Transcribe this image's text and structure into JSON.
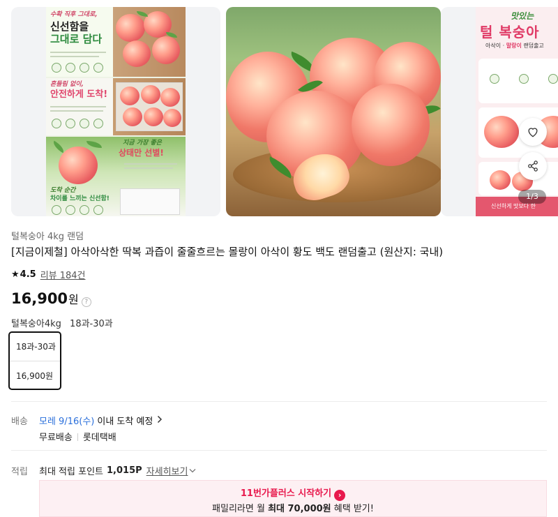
{
  "carousel": {
    "slide1": {
      "header_small": "수확 직후 그대로,",
      "header_big_1": "신선함을",
      "header_big_2": "그대로 담다",
      "mid_small": "흔들림 없이,",
      "mid_big": "안전하게 도착!",
      "bottom_small": "지금 가장 좋은",
      "bottom_big": "상태만 선별!",
      "bottom_left_small": "도착 순간",
      "bottom_left_big": "차이를 느끼는 신선함!"
    },
    "slide3": {
      "title_small": "맛있는",
      "title": "털 복숭아",
      "subtitle_pre": "아삭이 · ",
      "subtitle_highlight": "말랑이",
      "subtitle_post": " 랜덤출고",
      "banner": "신선하게 맛보다 한"
    },
    "counter": "1/3",
    "icons": {
      "wishlist": "heart-icon",
      "share": "share-icon"
    }
  },
  "product": {
    "category_label": "털복숭아 4kg 랜덤",
    "title": "[지금이제철] 아삭아삭한 딱복 과즙이 줄줄흐르는 몰랑이 아삭이 황도 백도 랜덤출고 (원산지: 국내)",
    "rating": "4.5",
    "review_label": "리뷰 184건",
    "price": "16,900",
    "price_unit": "원",
    "option_name": "털복숭아4kg",
    "option_value": "18과-30과"
  },
  "option_card": {
    "label": "18과-30과",
    "price": "16,900원"
  },
  "shipping": {
    "label": "배송",
    "date": "모레 9/16(수)",
    "date_suffix": "이내 도착 예정",
    "fee": "무료배송",
    "carrier": "롯데택배"
  },
  "points": {
    "label": "적립",
    "text": "최대 적립 포인트",
    "amount": "1,015P",
    "more": "자세히보기"
  },
  "promo": {
    "title": "11번가플러스 시작하기",
    "line_pre": "패밀리라면 월 ",
    "line_bold": "최대 70,000원",
    "line_post": " 혜택 받기!"
  }
}
